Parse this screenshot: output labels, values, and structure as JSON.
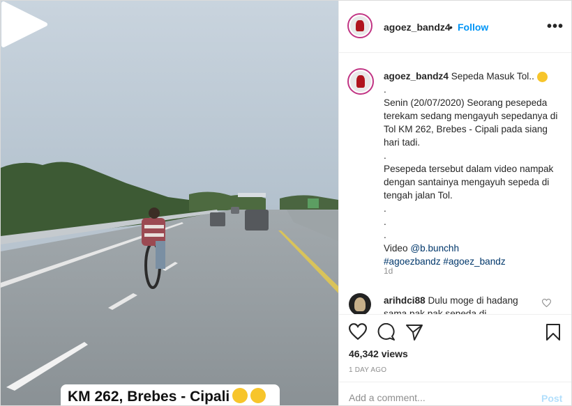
{
  "post": {
    "username": "agoez_bandz4",
    "follow_label": "Follow",
    "separator": "•",
    "more_label": "•••"
  },
  "video": {
    "overlay_text": "KM 262, Brebes - Cipali"
  },
  "caption": {
    "username": "agoez_bandz4",
    "title": "Sepeda Masuk Tol..",
    "lines": [
      ".",
      "Senin (20/07/2020) Seorang pesepeda terekam sedang mengayuh sepedanya di Tol KM 262, Brebes - Cipali pada siang hari tadi.",
      ".",
      "Pesepeda tersebut dalam video nampak dengan santainya mengayuh sepeda di tengah jalan Tol.",
      ".",
      ".",
      "."
    ],
    "video_prefix": "Video",
    "video_credit": "@b.bunchh",
    "hashtag1": "#agoezbandz",
    "hashtag2": "#agoez_bandz",
    "time": "1d"
  },
  "comment": {
    "username": "arihdci88",
    "text": "Dulu moge di hadang sama pak pak sepeda di"
  },
  "stats": {
    "likes": "46,342 views",
    "ago": "1 DAY AGO"
  },
  "add_comment": {
    "placeholder": "Add a comment...",
    "post_label": "Post"
  }
}
